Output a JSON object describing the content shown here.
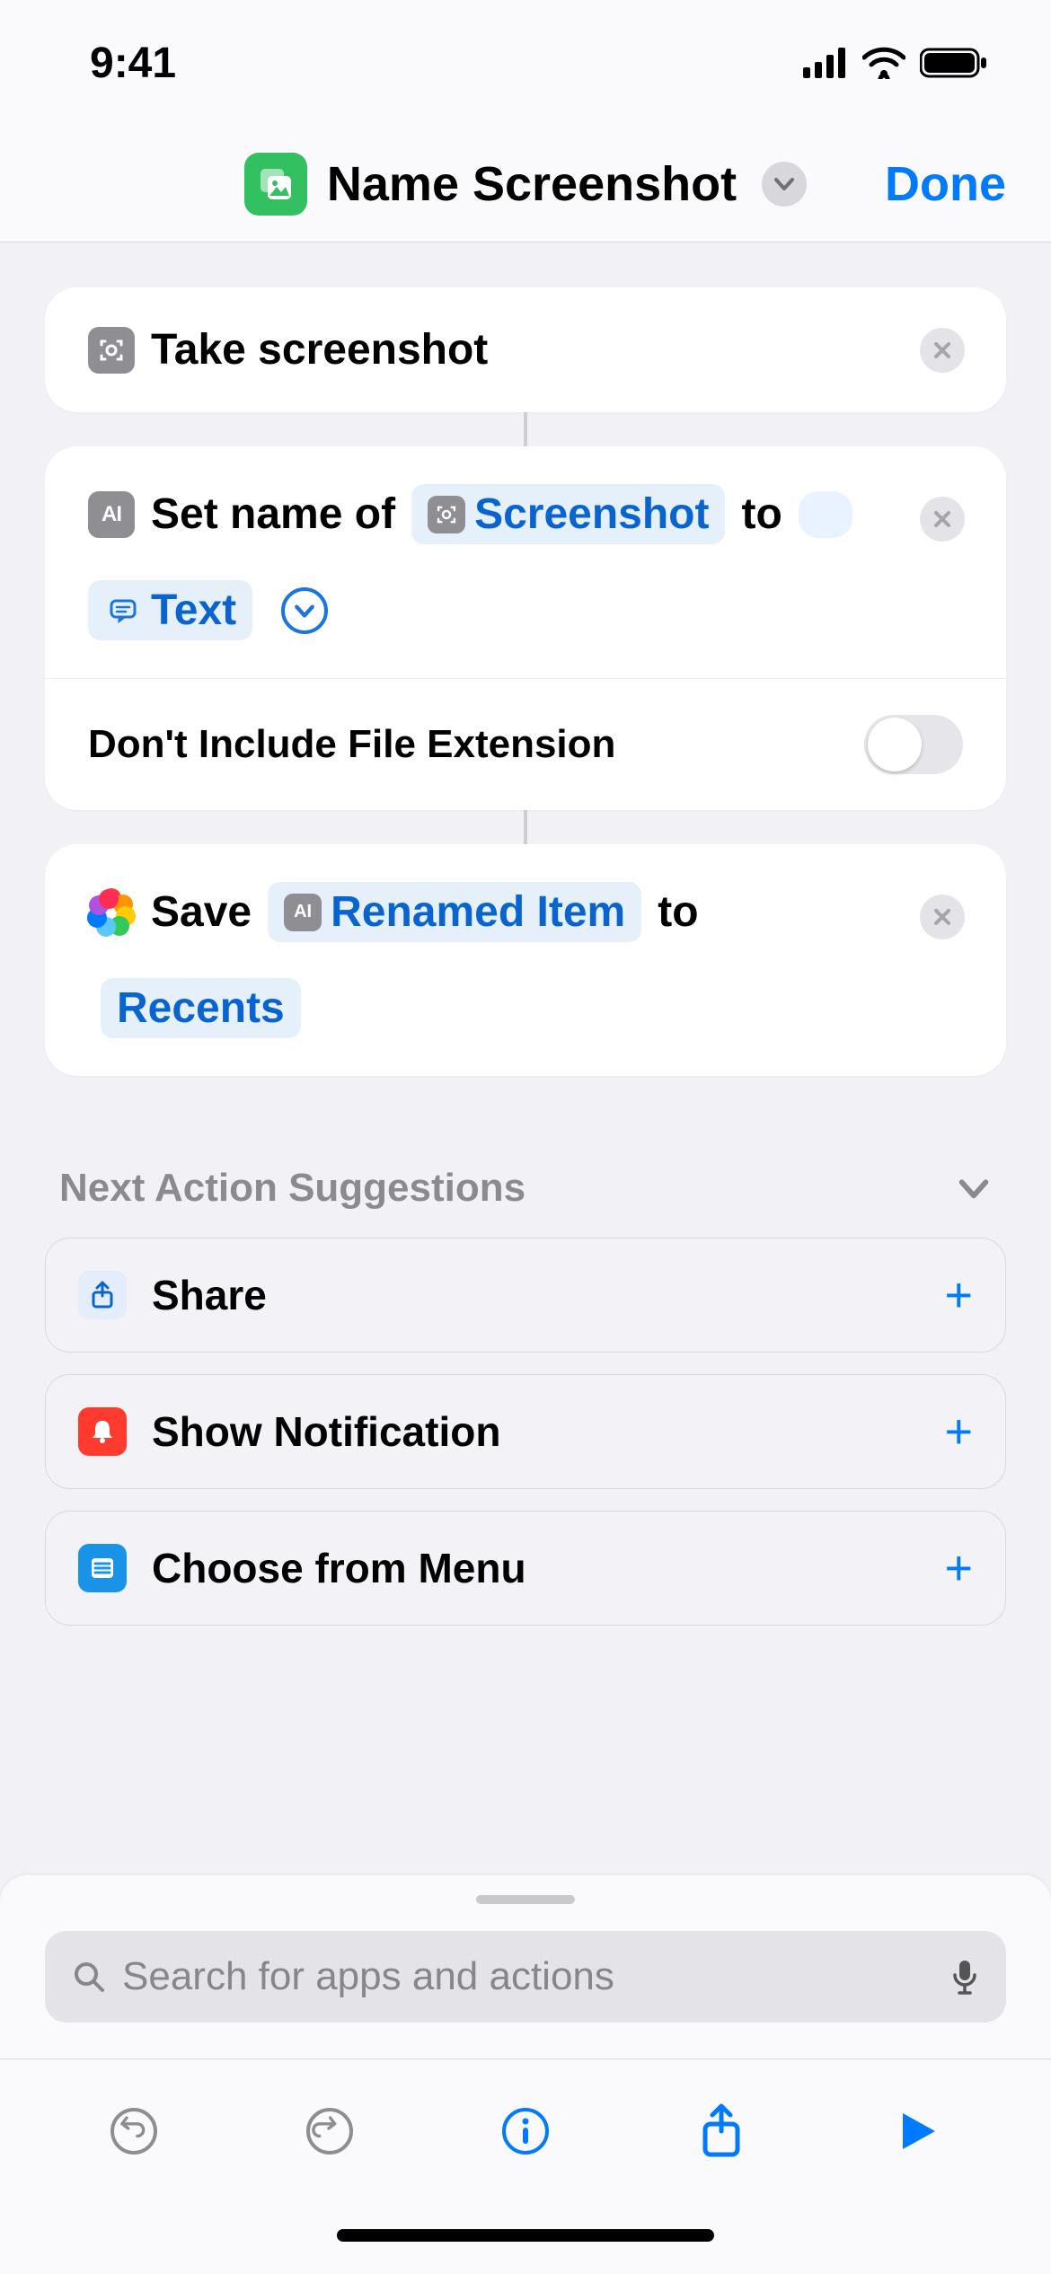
{
  "status": {
    "time": "9:41"
  },
  "header": {
    "title": "Name Screenshot",
    "done_label": "Done"
  },
  "actions": {
    "take_screenshot": {
      "label": "Take screenshot"
    },
    "set_name": {
      "prefix": "Set name of",
      "variable": "Screenshot",
      "mid": "to",
      "text_token": "Text",
      "option_label": "Don't Include File Extension",
      "option_on": false
    },
    "save": {
      "prefix": "Save",
      "variable": "Renamed Item",
      "mid": "to",
      "album": "Recents"
    }
  },
  "suggestions": {
    "header": "Next Action Suggestions",
    "items": [
      {
        "label": "Share",
        "icon": "share"
      },
      {
        "label": "Show Notification",
        "icon": "notif"
      },
      {
        "label": "Choose from Menu",
        "icon": "menu"
      }
    ]
  },
  "search": {
    "placeholder": "Search for apps and actions"
  }
}
